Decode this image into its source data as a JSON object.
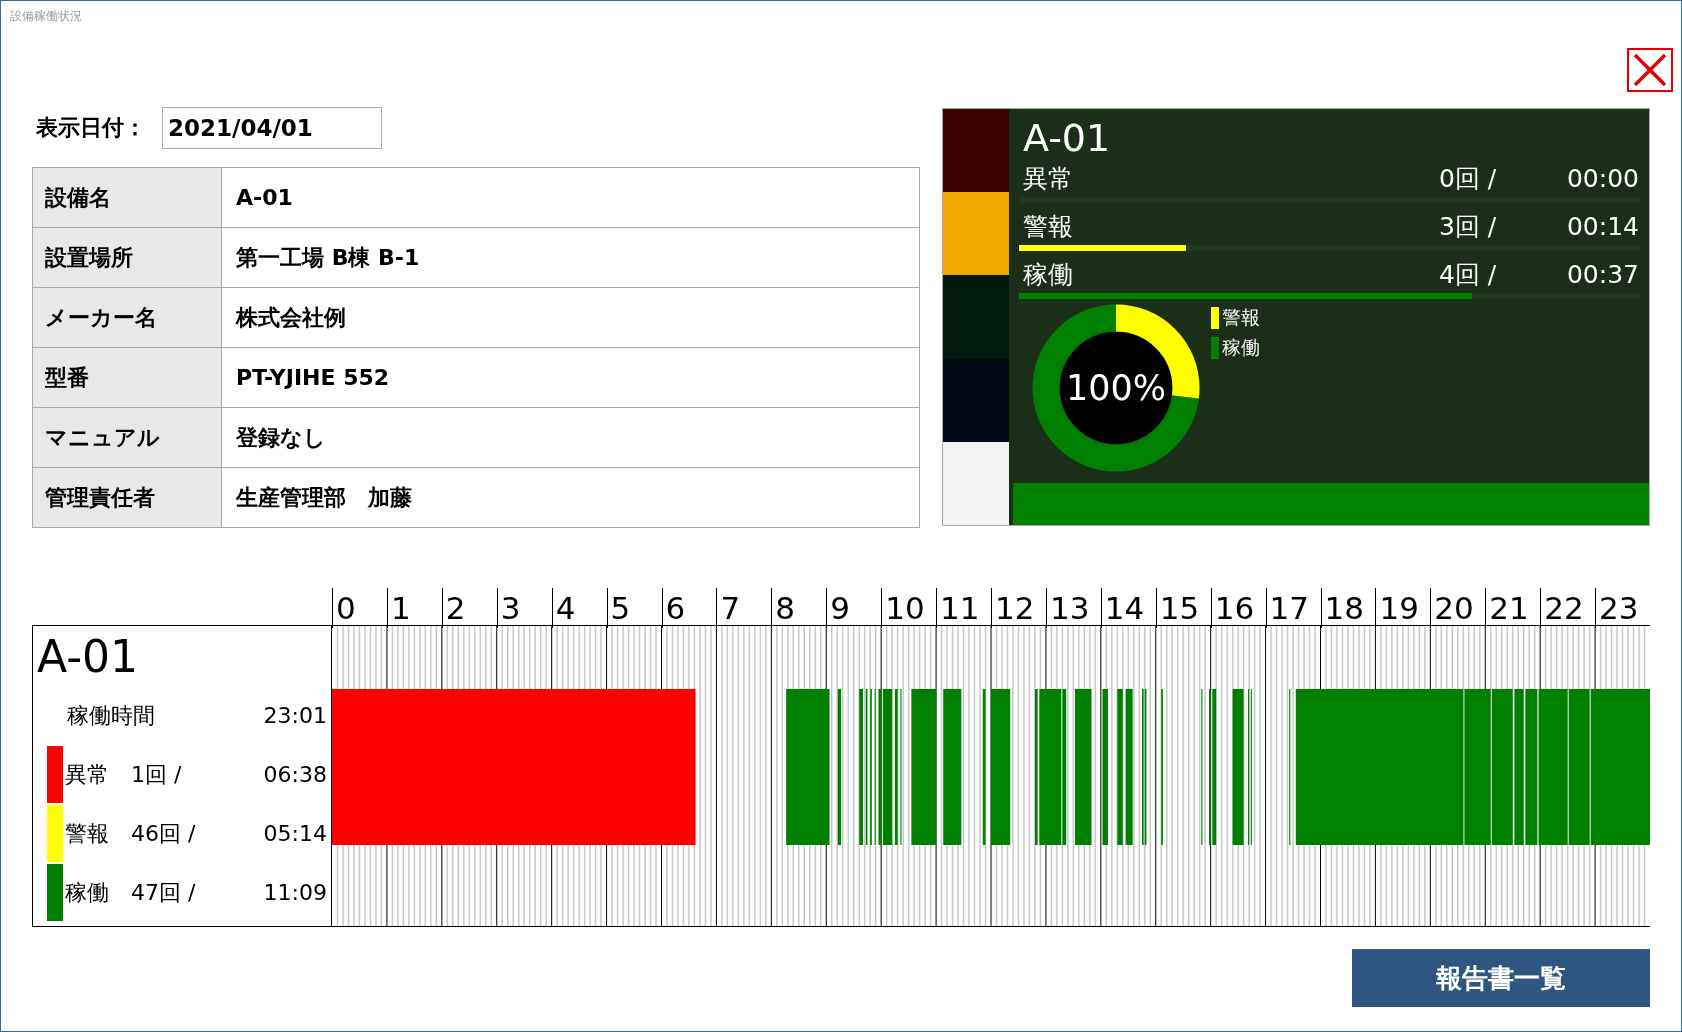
{
  "window": {
    "title": "設備稼働状況"
  },
  "display_date": {
    "label": "表示日付：",
    "value": "2021/04/01"
  },
  "equipment_info": [
    {
      "label": "設備名",
      "value": "A-01"
    },
    {
      "label": "設置場所",
      "value": "第一工場 B棟 B-1"
    },
    {
      "label": "メーカー名",
      "value": "株式会社例"
    },
    {
      "label": "型番",
      "value": "PT-YJIHE 552"
    },
    {
      "label": "マニュアル",
      "value": "登録なし"
    },
    {
      "label": "管理責任者",
      "value": "生産管理部　加藤"
    }
  ],
  "status_panel": {
    "swatches": [
      {
        "color": "#3a0000"
      },
      {
        "color": "#f0a800"
      },
      {
        "color": "#001a0d"
      },
      {
        "color": "#000a14"
      },
      {
        "color": "#f2f2f0"
      }
    ],
    "equipment": "A-01",
    "rows": [
      {
        "label": "異常",
        "count": "0回 /",
        "time": "00:00"
      },
      {
        "label": "警報",
        "count": "3回 /",
        "time": "00:14",
        "level": 0.27,
        "color": "#ffff00"
      },
      {
        "label": "稼働",
        "count": "4回 /",
        "time": "00:37",
        "level": 0.73,
        "color": "#008000"
      }
    ],
    "donut": {
      "center_label": "100%",
      "legend": [
        {
          "label": "警報",
          "color": "#ffff00"
        },
        {
          "label": "稼働",
          "color": "#008000"
        }
      ]
    }
  },
  "timeline": {
    "hours": [
      "0",
      "1",
      "2",
      "3",
      "4",
      "5",
      "6",
      "7",
      "8",
      "9",
      "10",
      "11",
      "12",
      "13",
      "14",
      "15",
      "16",
      "17",
      "18",
      "19",
      "20",
      "21",
      "22",
      "23"
    ],
    "equipment": "A-01",
    "summary": [
      {
        "kind": "total",
        "label": "稼働時間",
        "time": "23:01"
      },
      {
        "kind": "state",
        "label": "異常",
        "count": "1回 /",
        "time": "06:38",
        "color": "#ff0000"
      },
      {
        "kind": "state",
        "label": "警報",
        "count": "46回 /",
        "time": "05:14",
        "color": "#ffff00"
      },
      {
        "kind": "state",
        "label": "稼働",
        "count": "47回 /",
        "time": "11:09",
        "color": "#008000"
      }
    ]
  },
  "report_button": {
    "label": "報告書一覧"
  }
}
